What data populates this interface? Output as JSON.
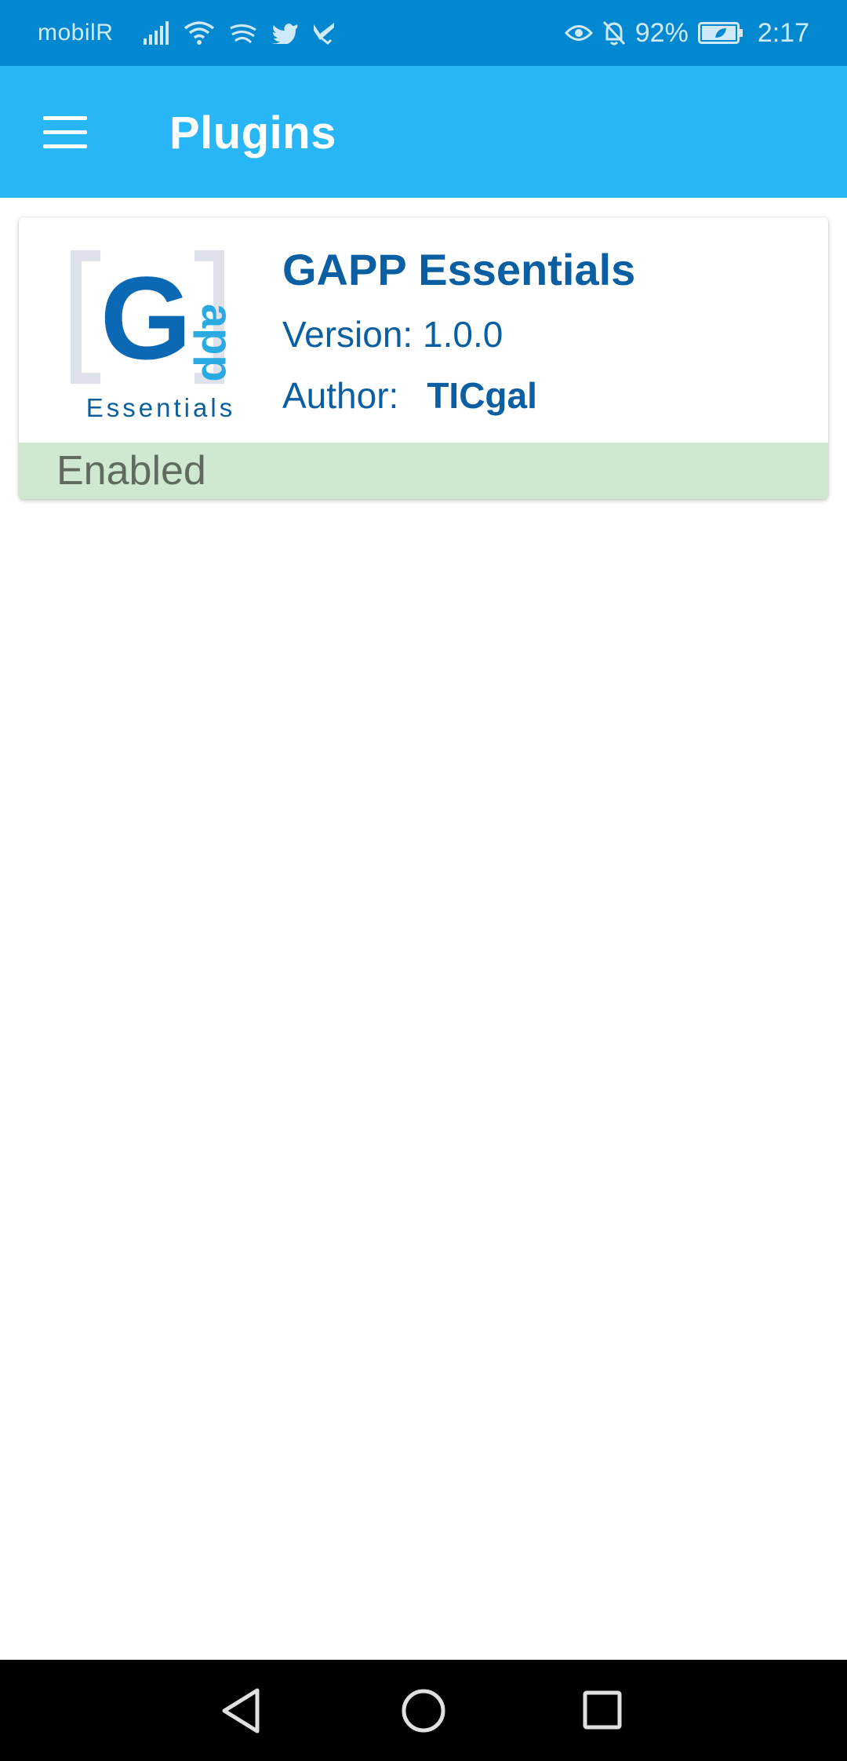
{
  "status_bar": {
    "carrier": "mobilR",
    "battery_percent": "92%",
    "time": "2:17",
    "left_icons": [
      "signal-icon",
      "wifi-icon",
      "swiftkey-icon",
      "twitter-icon",
      "feedly-icon"
    ],
    "right_icons": [
      "eye-comfort-icon",
      "bell-off-icon",
      "battery-icon"
    ]
  },
  "app_bar": {
    "title": "Plugins",
    "menu_icon": "hamburger-menu-icon",
    "background": "#29b6f6"
  },
  "plugins": [
    {
      "name": "GAPP Essentials",
      "version_label": "Version: 1.0.0",
      "author_label": "Author:",
      "author": "TICgal",
      "logo_letter": "G",
      "logo_side_text": "app",
      "logo_caption": "Essentials",
      "status": "Enabled",
      "status_color": "#cfe8cf"
    }
  ],
  "nav_bar": {
    "back_icon": "back-triangle-icon",
    "home_icon": "home-circle-icon",
    "recents_icon": "recents-square-icon"
  },
  "colors": {
    "status_bar": "#0288d1",
    "accent_text": "#0a5fa3",
    "logo_blue": "#0b68b4",
    "logo_light_blue": "#29abe2"
  }
}
